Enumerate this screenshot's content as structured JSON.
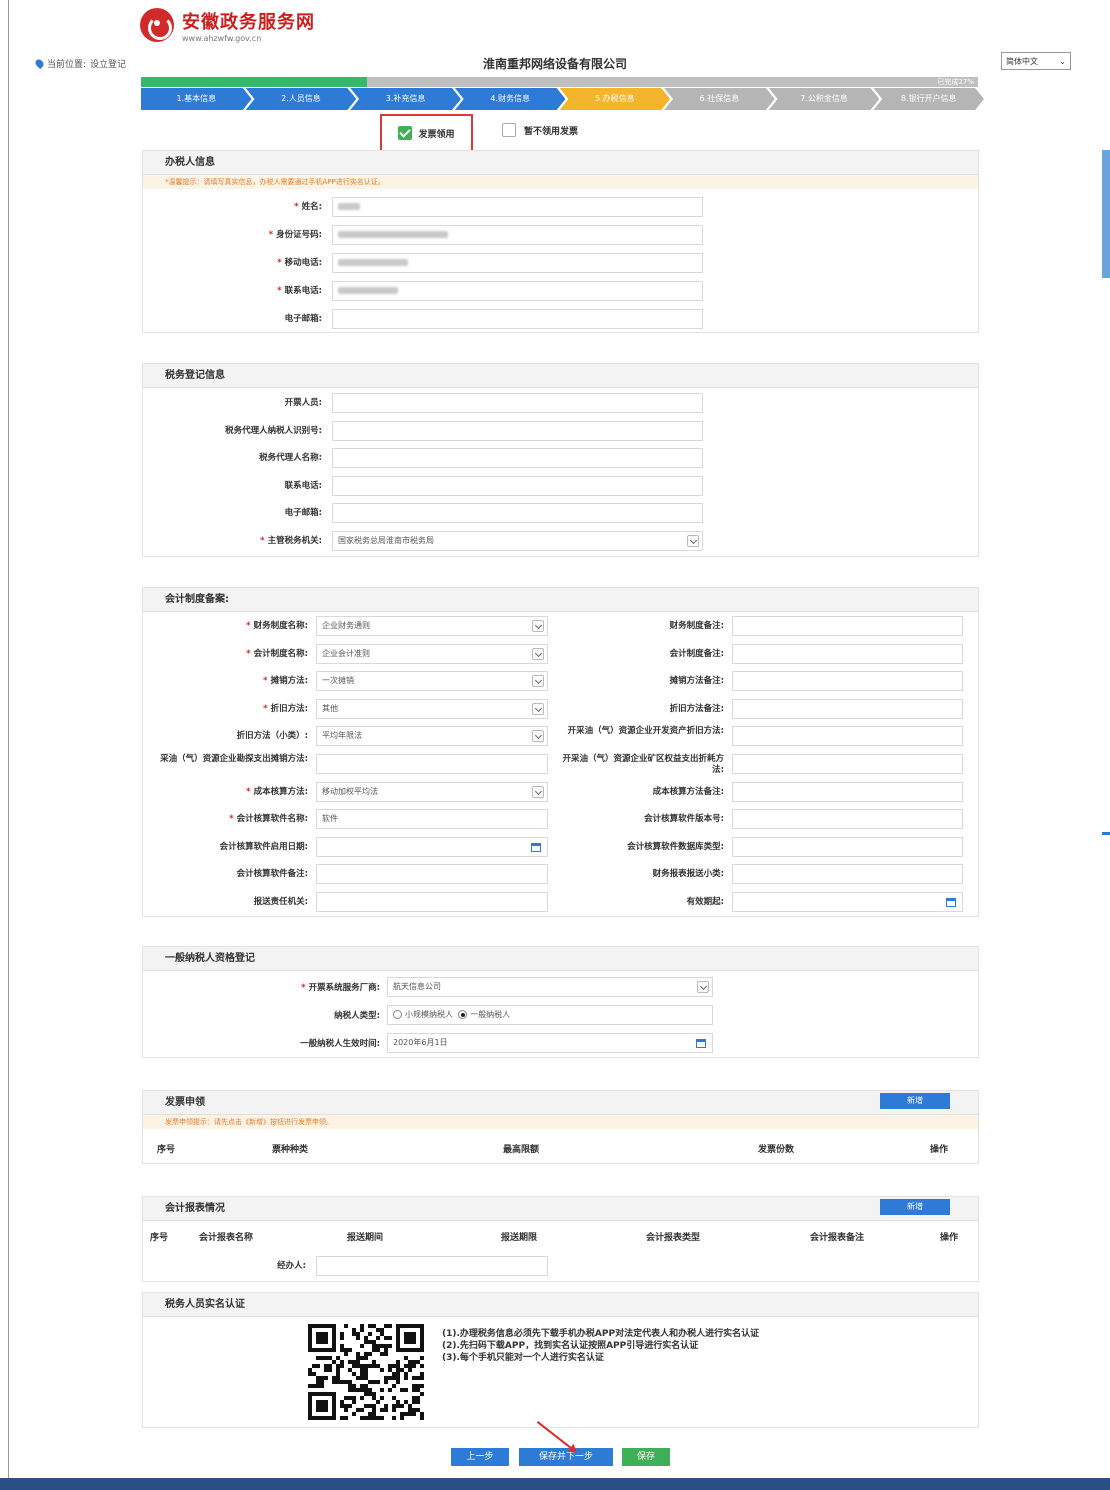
{
  "site": {
    "name_cn": "安徽政务服务网",
    "url": "www.ahzwfw.gov.cn"
  },
  "location": {
    "label": "当前位置:",
    "value": "设立登记"
  },
  "company_title": "淮南重邦网络设备有限公司",
  "lang_select": "简体中文",
  "progress": {
    "percent": 27,
    "label": "已完成27%"
  },
  "steps": [
    {
      "label": "1.基本信息",
      "state": "done"
    },
    {
      "label": "2.人员信息",
      "state": "done"
    },
    {
      "label": "3.补充信息",
      "state": "done"
    },
    {
      "label": "4.财务信息",
      "state": "done"
    },
    {
      "label": "5.办税信息",
      "state": "current"
    },
    {
      "label": "6.社保信息",
      "state": "todo"
    },
    {
      "label": "7.公积金信息",
      "state": "todo"
    },
    {
      "label": "8.银行开户信息",
      "state": "todo"
    }
  ],
  "invoice_choice": {
    "apply": "发票领用",
    "no_apply": "暂不领用发票"
  },
  "taxpayer_handler": {
    "title": "办税人信息",
    "tip": "*温馨提示：请填写真实信息，办税人需要通过手机APP进行实名认证。",
    "fields": [
      {
        "label": "姓名:",
        "required": true
      },
      {
        "label": "身份证号码:",
        "required": true
      },
      {
        "label": "移动电话:",
        "required": true
      },
      {
        "label": "联系电话:",
        "required": true
      },
      {
        "label": "电子邮箱:",
        "required": false
      }
    ]
  },
  "tax_registration": {
    "title": "税务登记信息",
    "fields": [
      {
        "label": "开票人员:",
        "required": false,
        "value": ""
      },
      {
        "label": "税务代理人纳税人识别号:",
        "required": false,
        "value": ""
      },
      {
        "label": "税务代理人名称:",
        "required": false,
        "value": ""
      },
      {
        "label": "联系电话:",
        "required": false,
        "value": ""
      },
      {
        "label": "电子邮箱:",
        "required": false,
        "value": ""
      },
      {
        "label": "主管税务机关:",
        "required": true,
        "value": "国家税务总局淮南市税务局"
      }
    ]
  },
  "accounting": {
    "title": "会计制度备案:",
    "left": [
      {
        "label": "财务制度名称:",
        "required": true,
        "value": "企业财务通则",
        "kind": "select"
      },
      {
        "label": "会计制度名称:",
        "required": true,
        "value": "企业会计准则",
        "kind": "select"
      },
      {
        "label": "摊销方法:",
        "required": true,
        "value": "一次摊销",
        "kind": "select"
      },
      {
        "label": "折旧方法:",
        "required": true,
        "value": "其他",
        "kind": "select"
      },
      {
        "label": "折旧方法（小类）:",
        "required": false,
        "value": "平均年限法",
        "kind": "select"
      },
      {
        "label": "采油（气）资源企业勘探支出摊销方法:",
        "required": false,
        "value": "",
        "kind": "text"
      },
      {
        "label": "成本核算方法:",
        "required": true,
        "value": "移动加权平均法",
        "kind": "select"
      },
      {
        "label": "会计核算软件名称:",
        "required": true,
        "value": "软件",
        "kind": "text"
      },
      {
        "label": "会计核算软件启用日期:",
        "required": false,
        "value": "",
        "kind": "date"
      },
      {
        "label": "会计核算软件备注:",
        "required": false,
        "value": "",
        "kind": "text"
      },
      {
        "label": "报送责任机关:",
        "required": false,
        "value": "",
        "kind": "text"
      }
    ],
    "right": [
      {
        "label": "财务制度备注:",
        "kind": "text"
      },
      {
        "label": "会计制度备注:",
        "kind": "text"
      },
      {
        "label": "摊销方法备注:",
        "kind": "text"
      },
      {
        "label": "折旧方法备注:",
        "kind": "text"
      },
      {
        "label": "开采油（气）资源企业开发资产折旧方法:",
        "kind": "text"
      },
      {
        "label": "开采油（气）资源企业矿区权益支出折耗方法:",
        "kind": "text"
      },
      {
        "label": "成本核算方法备注:",
        "kind": "text"
      },
      {
        "label": "会计核算软件版本号:",
        "kind": "text"
      },
      {
        "label": "会计核算软件数据库类型:",
        "kind": "text"
      },
      {
        "label": "财务报表报送小类:",
        "kind": "text"
      },
      {
        "label": "有效期起:",
        "kind": "date"
      }
    ]
  },
  "general_taxpayer": {
    "title": "一般纳税人资格登记",
    "provider_label": "开票系统服务厂商:",
    "provider_value": "航天信息公司",
    "type_label": "纳税人类型:",
    "type_options": [
      "小规模纳税人",
      "一般纳税人"
    ],
    "type_selected": "一般纳税人",
    "effective_label": "一般纳税人生效时间:",
    "effective_value": "2020年6月1日"
  },
  "invoice_apply": {
    "title": "发票申领",
    "add_label": "新增",
    "tip": "发票申领提示：请先点击《新增》按钮进行发票申领。",
    "columns": [
      "序号",
      "票种种类",
      "最高限额",
      "发票份数",
      "操作"
    ]
  },
  "accounting_reports": {
    "title": "会计报表情况",
    "add_label": "新增",
    "columns": [
      "序号",
      "会计报表名称",
      "报送期间",
      "报送期限",
      "会计报表类型",
      "会计报表备注",
      "操作"
    ],
    "handler_label": "经办人:"
  },
  "real_name": {
    "title": "税务人员实名认证",
    "notes": [
      "(1).办理税务信息必须先下载手机办税APP对法定代表人和办税人进行实名认证",
      "(2).先扫码下载APP，找到实名认证按照APP引导进行实名认证",
      "(3).每个手机只能对一个人进行实名认证"
    ]
  },
  "buttons": {
    "prev": "上一步",
    "save_next": "保存并下一步",
    "save": "保存"
  },
  "colors": {
    "primary": "#2d7bd6",
    "success": "#3fb058",
    "warning": "#f4b42c",
    "danger": "#d63b3b"
  }
}
